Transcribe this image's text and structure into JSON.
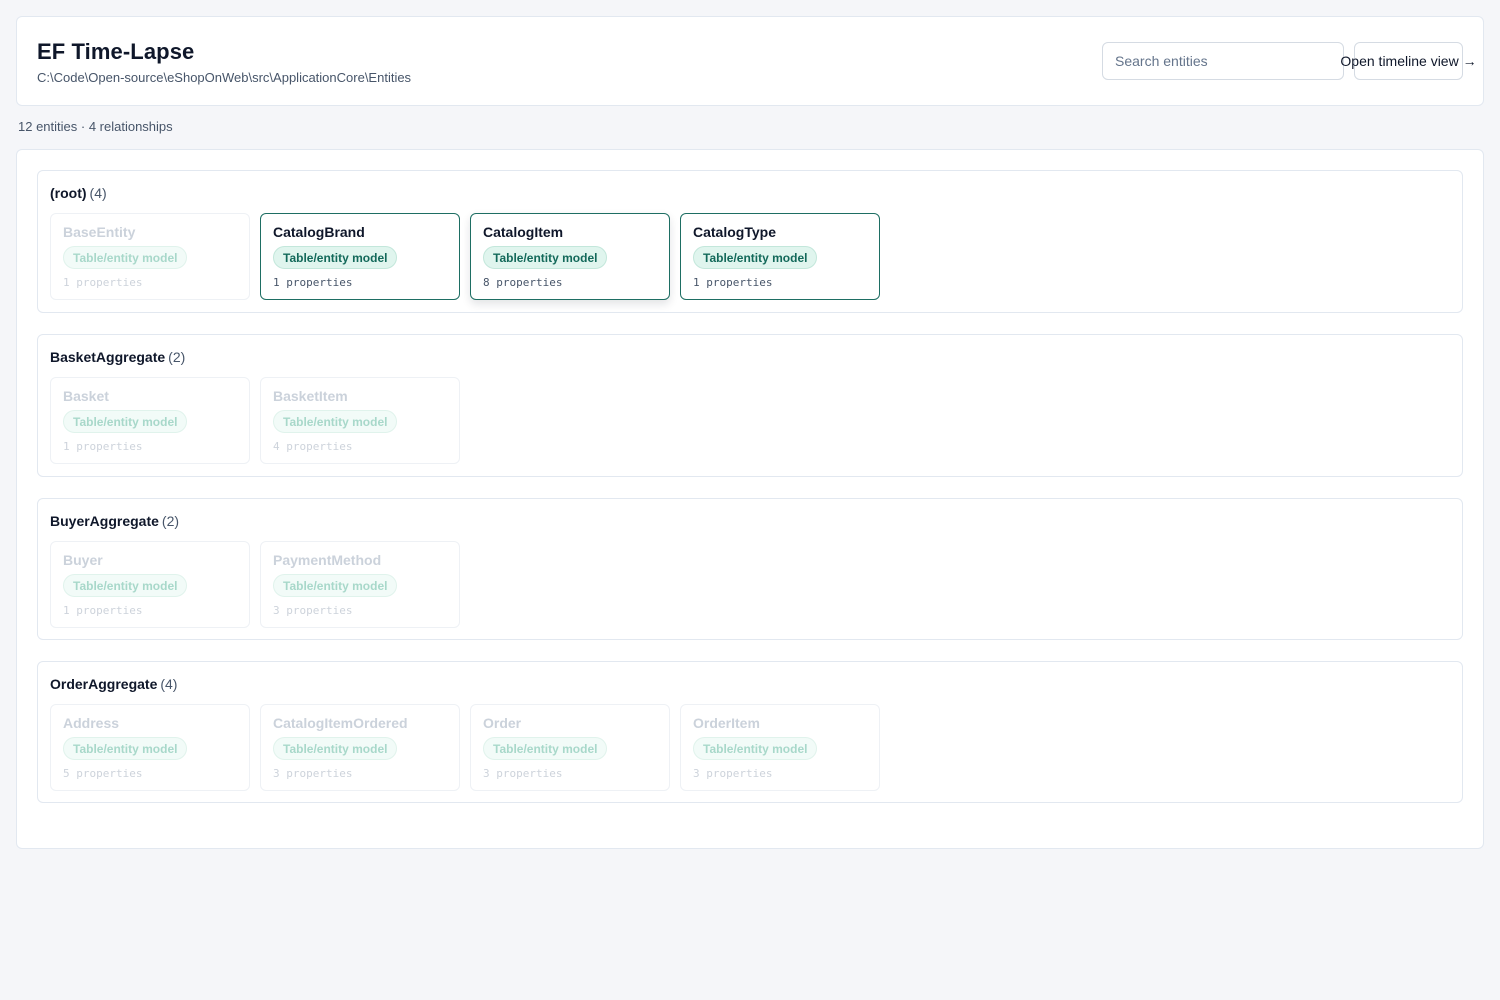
{
  "header": {
    "title": "EF Time-Lapse",
    "path": "C:\\Code\\Open-source\\eShopOnWeb\\src\\ApplicationCore\\Entities",
    "search_placeholder": "Search entities",
    "timeline_button_label": "Open timeline view →"
  },
  "summary": "12 entities · 4 relationships",
  "colors": {
    "accent": "#1e6e63",
    "badge_text": "#13695a",
    "badge_bg": "#e0f5ee"
  },
  "groups": [
    {
      "name": "(root)",
      "count": "(4)",
      "entities": [
        {
          "name": "BaseEntity",
          "badge": "Table/entity model",
          "props": "1 properties",
          "active": false
        },
        {
          "name": "CatalogBrand",
          "badge": "Table/entity model",
          "props": "1 properties",
          "active": true
        },
        {
          "name": "CatalogItem",
          "badge": "Table/entity model",
          "props": "8 properties",
          "active": true
        },
        {
          "name": "CatalogType",
          "badge": "Table/entity model",
          "props": "1 properties",
          "active": true
        }
      ]
    },
    {
      "name": "BasketAggregate",
      "count": "(2)",
      "entities": [
        {
          "name": "Basket",
          "badge": "Table/entity model",
          "props": "1 properties",
          "active": false
        },
        {
          "name": "BasketItem",
          "badge": "Table/entity model",
          "props": "4 properties",
          "active": false
        }
      ]
    },
    {
      "name": "BuyerAggregate",
      "count": "(2)",
      "entities": [
        {
          "name": "Buyer",
          "badge": "Table/entity model",
          "props": "1 properties",
          "active": false
        },
        {
          "name": "PaymentMethod",
          "badge": "Table/entity model",
          "props": "3 properties",
          "active": false
        }
      ]
    },
    {
      "name": "OrderAggregate",
      "count": "(4)",
      "entities": [
        {
          "name": "Address",
          "badge": "Table/entity model",
          "props": "5 properties",
          "active": false
        },
        {
          "name": "CatalogItemOrdered",
          "badge": "Table/entity model",
          "props": "3 properties",
          "active": false
        },
        {
          "name": "Order",
          "badge": "Table/entity model",
          "props": "3 properties",
          "active": false
        },
        {
          "name": "OrderItem",
          "badge": "Table/entity model",
          "props": "3 properties",
          "active": false
        }
      ]
    }
  ]
}
